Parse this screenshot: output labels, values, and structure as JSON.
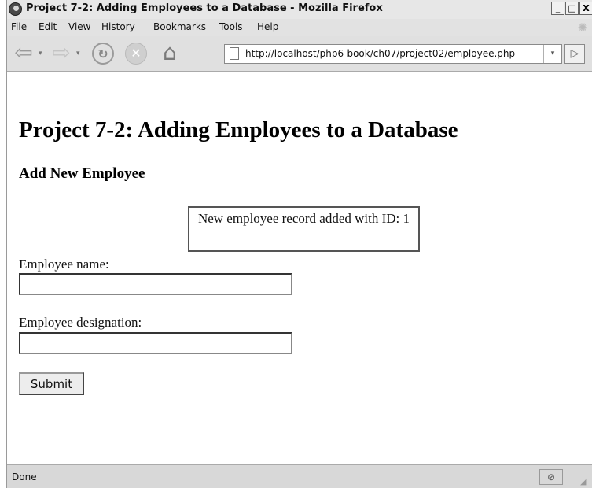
{
  "window": {
    "title": "Project 7-2: Adding Employees to a Database - Mozilla Firefox",
    "minimize": "_",
    "maximize": "□",
    "close": "X"
  },
  "menu": {
    "items": [
      "File",
      "Edit",
      "View",
      "History",
      "Bookmarks",
      "Tools",
      "Help"
    ]
  },
  "toolbar": {
    "back_glyph": "⇦",
    "forward_glyph": "⇨",
    "dropdown_glyph": "▾",
    "reload_glyph": "↻",
    "stop_glyph": "✕",
    "home_glyph": "⌂",
    "go_glyph": "▷",
    "url": "http://localhost/php6-book/ch07/project02/employee.php"
  },
  "page": {
    "heading": "Project 7-2: Adding Employees to a Database",
    "subheading": "Add New Employee",
    "message": "New employee record added with ID: 1",
    "name_label": "Employee name:",
    "name_value": "",
    "designation_label": "Employee designation:",
    "designation_value": "",
    "submit_label": "Submit"
  },
  "status": {
    "text": "Done"
  },
  "icons": {
    "firefox": "firefox-icon",
    "back": "back-arrow-icon",
    "forward": "forward-arrow-icon",
    "reload": "reload-icon",
    "stop": "stop-icon",
    "home": "home-icon",
    "page": "page-icon",
    "go": "go-arrow-icon",
    "throbber": "throbber-icon",
    "resize": "resize-grip-icon"
  },
  "colors": {
    "chrome": "#d6d6d6",
    "content": "#ffffff",
    "message_border": "#555555"
  }
}
